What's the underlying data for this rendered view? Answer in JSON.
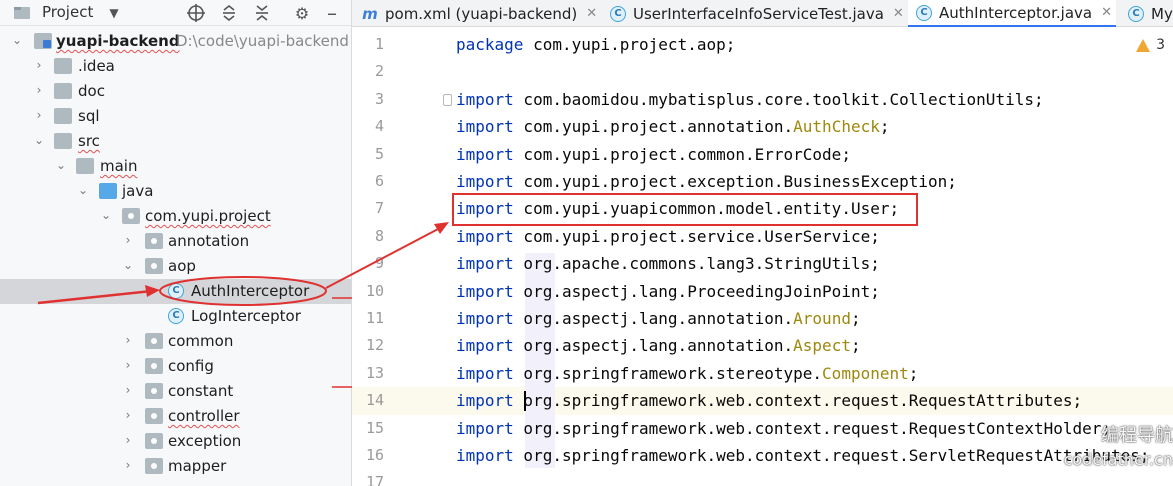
{
  "project_panel": {
    "title": "Project",
    "tree": [
      {
        "label": "yuapi-backend",
        "path": "D:\\code\\yuapi-backend",
        "depth": 0,
        "icon": "module-folder-icon",
        "expanded": true
      },
      {
        "label": ".idea",
        "depth": 1,
        "icon": "folder-icon",
        "expanded": false
      },
      {
        "label": "doc",
        "depth": 1,
        "icon": "folder-icon",
        "expanded": false
      },
      {
        "label": "sql",
        "depth": 1,
        "icon": "folder-icon",
        "expanded": false
      },
      {
        "label": "src",
        "depth": 1,
        "icon": "folder-icon",
        "expanded": true
      },
      {
        "label": "main",
        "depth": 2,
        "icon": "folder-icon",
        "expanded": true
      },
      {
        "label": "java",
        "depth": 3,
        "icon": "source-folder-icon",
        "expanded": true
      },
      {
        "label": "com.yupi.project",
        "depth": 4,
        "icon": "package-icon",
        "expanded": true
      },
      {
        "label": "annotation",
        "depth": 5,
        "icon": "package-icon",
        "expanded": false
      },
      {
        "label": "aop",
        "depth": 5,
        "icon": "package-icon",
        "expanded": true
      },
      {
        "label": "AuthInterceptor",
        "depth": 6,
        "icon": "class-icon",
        "selected": true
      },
      {
        "label": "LogInterceptor",
        "depth": 6,
        "icon": "class-icon"
      },
      {
        "label": "common",
        "depth": 5,
        "icon": "package-icon",
        "expanded": false
      },
      {
        "label": "config",
        "depth": 5,
        "icon": "package-icon",
        "expanded": false
      },
      {
        "label": "constant",
        "depth": 5,
        "icon": "package-icon",
        "expanded": false
      },
      {
        "label": "controller",
        "depth": 5,
        "icon": "package-icon",
        "expanded": false
      },
      {
        "label": "exception",
        "depth": 5,
        "icon": "package-icon",
        "expanded": false
      },
      {
        "label": "mapper",
        "depth": 5,
        "icon": "package-icon",
        "expanded": false
      }
    ]
  },
  "editor": {
    "tabs": [
      {
        "label": "pom.xml (yuapi-backend)",
        "icon": "maven-icon",
        "active": false
      },
      {
        "label": "UserInterfaceInfoServiceTest.java",
        "icon": "class-icon",
        "active": false
      },
      {
        "label": "AuthInterceptor.java",
        "icon": "class-icon",
        "active": true
      },
      {
        "label": "My",
        "icon": "class-icon",
        "active": false
      }
    ],
    "warning_count": "3",
    "lines": [
      {
        "num": "1",
        "kw": "package",
        "text": " com.yupi.project.aop;",
        "ann": ""
      },
      {
        "num": "2",
        "kw": "",
        "text": "",
        "ann": ""
      },
      {
        "num": "3",
        "kw": "import",
        "text": " com.baomidou.mybatisplus.core.toolkit.CollectionUtils;",
        "ann": ""
      },
      {
        "num": "4",
        "kw": "import",
        "text": " com.yupi.project.annotation.",
        "ann": "AuthCheck",
        "tail": ";"
      },
      {
        "num": "5",
        "kw": "import",
        "text": " com.yupi.project.common.ErrorCode;",
        "ann": ""
      },
      {
        "num": "6",
        "kw": "import",
        "text": " com.yupi.project.exception.BusinessException;",
        "ann": ""
      },
      {
        "num": "7",
        "kw": "import",
        "text": " com.yupi.yuapicommon.model.entity.User;",
        "ann": ""
      },
      {
        "num": "8",
        "kw": "import",
        "text": " com.yupi.project.service.UserService;",
        "ann": ""
      },
      {
        "num": "9",
        "kw": "import",
        "text": " org.apache.commons.lang3.StringUtils;",
        "ann": ""
      },
      {
        "num": "10",
        "kw": "import",
        "text": " org.aspectj.lang.ProceedingJoinPoint;",
        "ann": ""
      },
      {
        "num": "11",
        "kw": "import",
        "text": " org.aspectj.lang.annotation.",
        "ann": "Around",
        "tail": ";"
      },
      {
        "num": "12",
        "kw": "import",
        "text": " org.aspectj.lang.annotation.",
        "ann": "Aspect",
        "tail": ";"
      },
      {
        "num": "13",
        "kw": "import",
        "text": " org.springframework.stereotype.",
        "ann": "Component",
        "tail": ";"
      },
      {
        "num": "14",
        "kw": "import",
        "text": " org.springframework.web.context.request.RequestAttributes;",
        "ann": ""
      },
      {
        "num": "15",
        "kw": "import",
        "text": " org.springframework.web.context.request.RequestContextHolder;",
        "ann": ""
      },
      {
        "num": "16",
        "kw": "import",
        "text": " org.springframework.web.context.request.ServletRequestAttributes;",
        "ann": ""
      },
      {
        "num": "17",
        "kw": "",
        "text": "",
        "ann": ""
      }
    ]
  },
  "watermark": {
    "line1": "编程导航",
    "line2": "codefather.cn"
  },
  "colors": {
    "annotation_red": "#e03131",
    "keyword": "#0033b3",
    "annotation_type": "#9e880d"
  }
}
